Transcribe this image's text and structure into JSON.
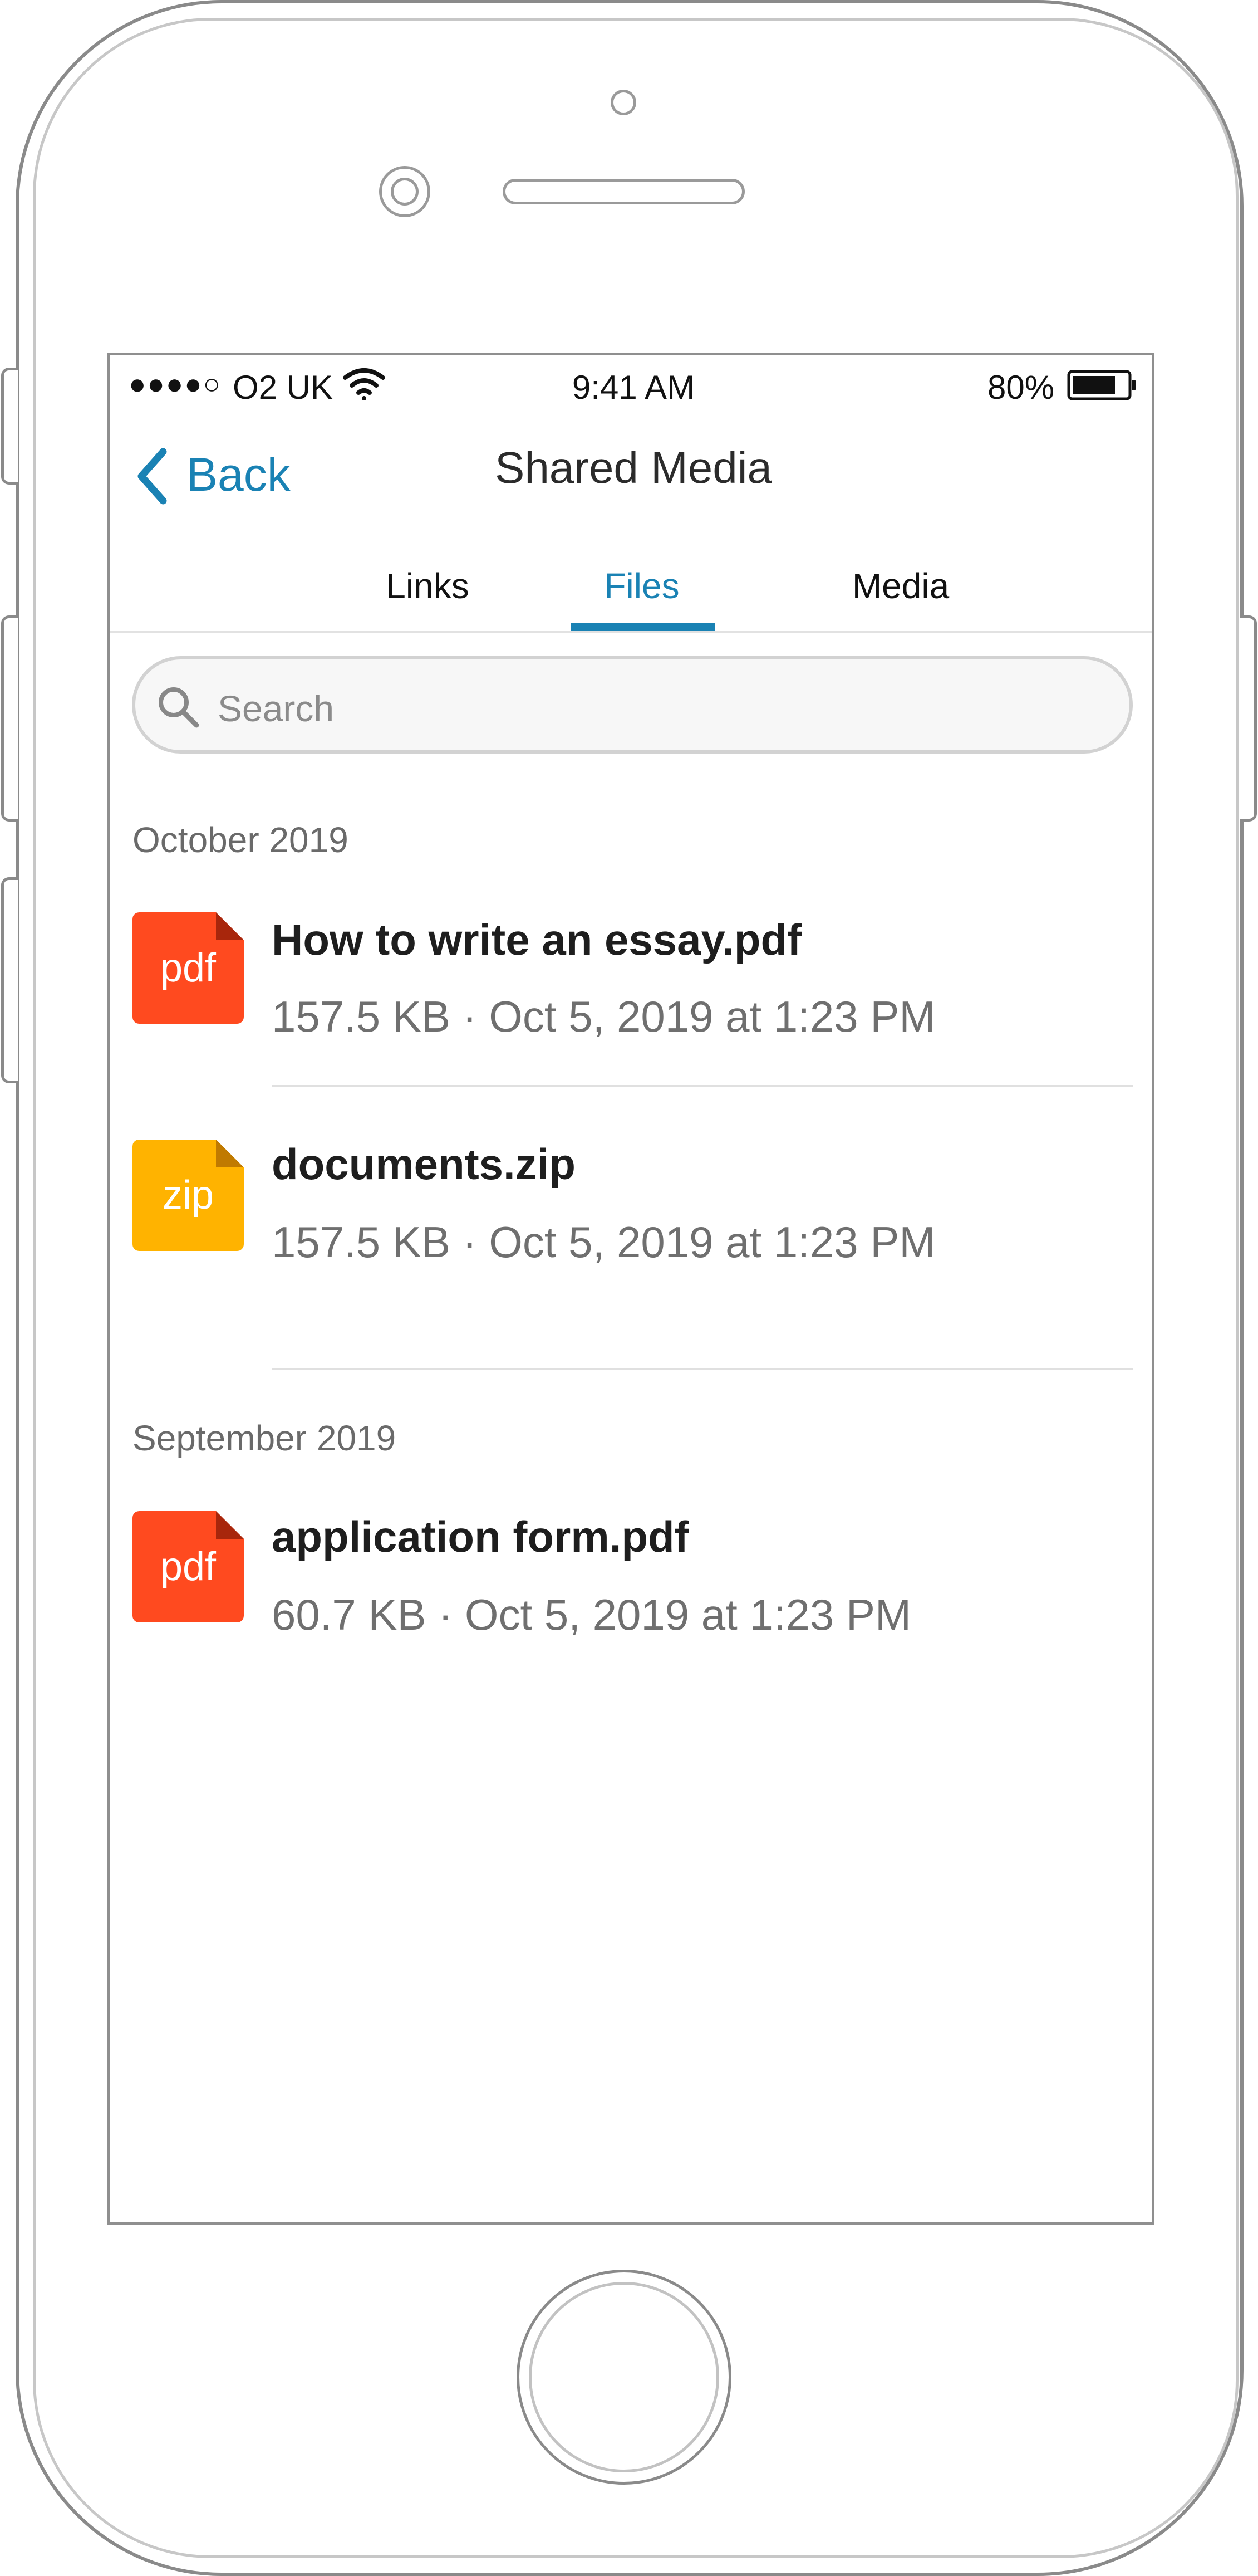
{
  "status_bar": {
    "signal_dots": "●●●●○",
    "carrier": "O2 UK",
    "time": "9:41 AM",
    "battery_percent": "80%",
    "battery_level": 0.8
  },
  "nav": {
    "back_label": "Back",
    "title": "Shared Media"
  },
  "tabs": [
    {
      "label": "Links",
      "active": false
    },
    {
      "label": "Files",
      "active": true
    },
    {
      "label": "Media",
      "active": false
    }
  ],
  "search": {
    "placeholder": "Search"
  },
  "sections": [
    {
      "header": "October 2019",
      "files": [
        {
          "name": "How to write an essay.pdf",
          "meta": "157.5 KB · Oct 5, 2019 at 1:23 PM",
          "type": "pdf"
        },
        {
          "name": "documents.zip",
          "meta": "157.5 KB · Oct 5, 2019 at 1:23 PM",
          "type": "zip"
        }
      ]
    },
    {
      "header": "September 2019",
      "files": [
        {
          "name": "application form.pdf",
          "meta": "60.7 KB · Oct 5, 2019 at 1:23 PM",
          "type": "pdf"
        }
      ]
    }
  ],
  "colors": {
    "accent": "#1a82b4",
    "pdf": "#ff4a1f",
    "pdf_fold": "#a8260c",
    "zip": "#ffb300",
    "zip_fold": "#c07a00"
  },
  "icons": {
    "back": "chevron-left-icon",
    "search": "search-icon",
    "wifi": "wifi-icon",
    "battery": "battery-icon"
  }
}
